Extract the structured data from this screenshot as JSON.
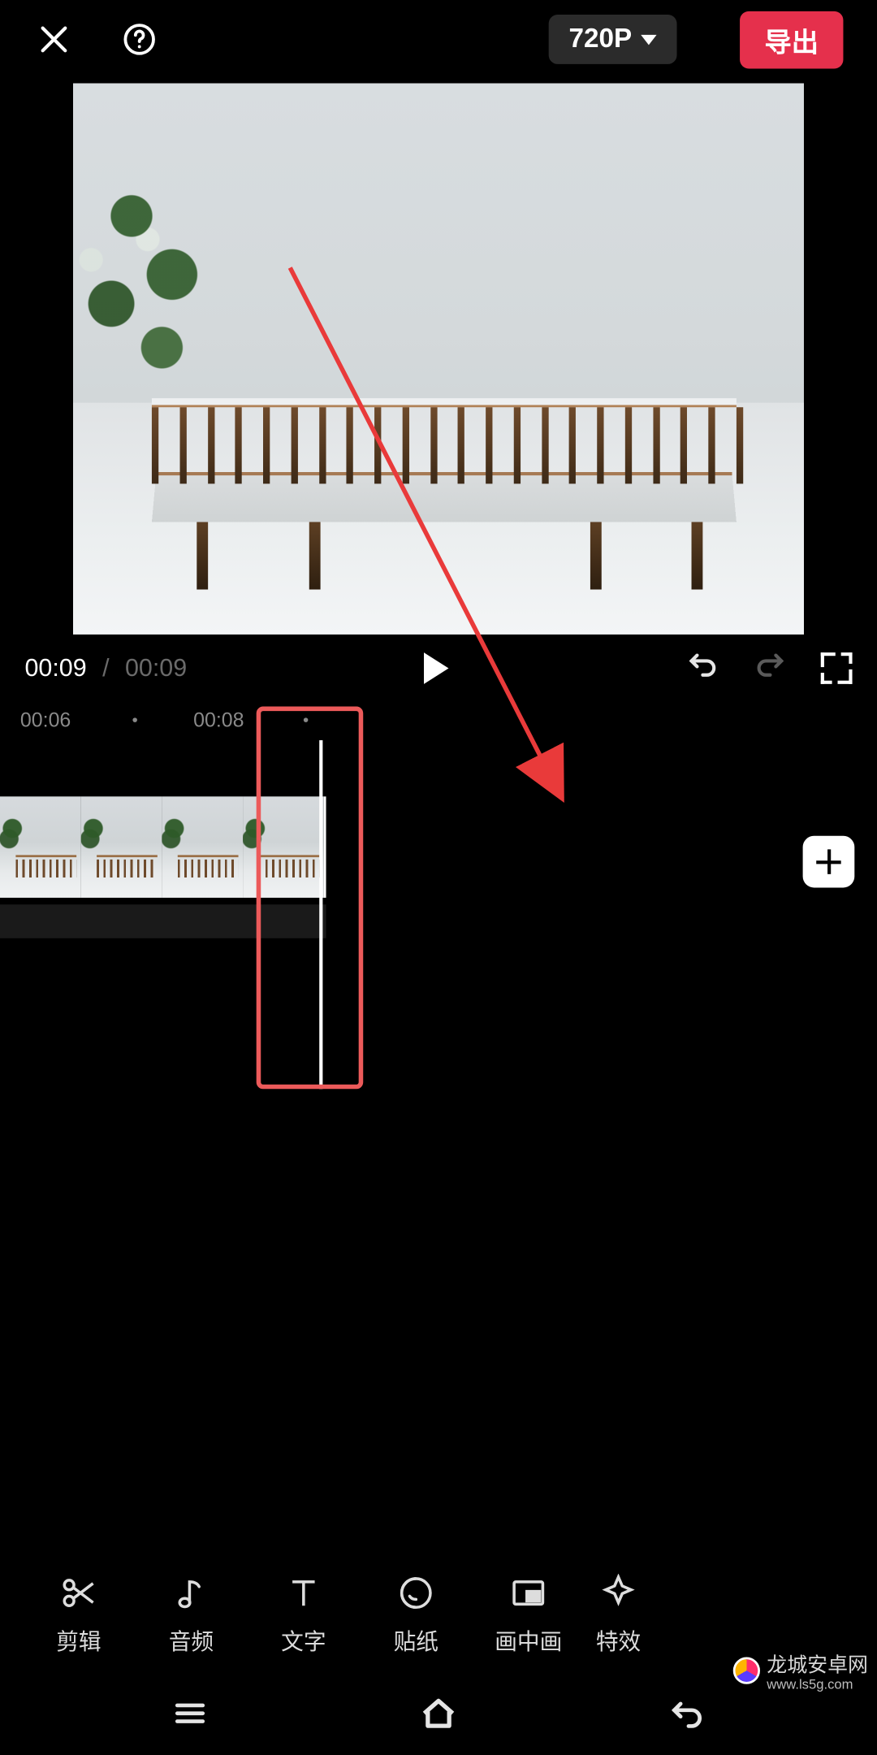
{
  "topbar": {
    "resolution_label": "720P",
    "export_label": "导出"
  },
  "transport": {
    "current_time": "00:09",
    "total_time": "00:09"
  },
  "ruler": {
    "ticks": [
      "00:06",
      "00:08"
    ]
  },
  "tools": [
    {
      "id": "cut",
      "label": "剪辑",
      "icon": "scissors-icon"
    },
    {
      "id": "audio",
      "label": "音频",
      "icon": "music-note-icon"
    },
    {
      "id": "text",
      "label": "文字",
      "icon": "text-icon"
    },
    {
      "id": "sticker",
      "label": "贴纸",
      "icon": "sticker-icon"
    },
    {
      "id": "pip",
      "label": "画中画",
      "icon": "pip-icon"
    },
    {
      "id": "fx",
      "label": "特效",
      "icon": "sparkle-icon"
    }
  ],
  "watermark": {
    "brand": "龙城安卓网",
    "url": "www.ls5g.com"
  },
  "icons": {
    "close": "close-icon",
    "help": "help-icon",
    "play": "play-icon",
    "undo": "undo-icon",
    "redo": "redo-icon",
    "fullscreen": "fullscreen-icon",
    "add": "plus-icon",
    "menu": "menu-icon",
    "home": "home-icon",
    "back": "back-icon"
  },
  "colors": {
    "export_button": "#e5304c",
    "annotation": "#ec5a5a"
  }
}
